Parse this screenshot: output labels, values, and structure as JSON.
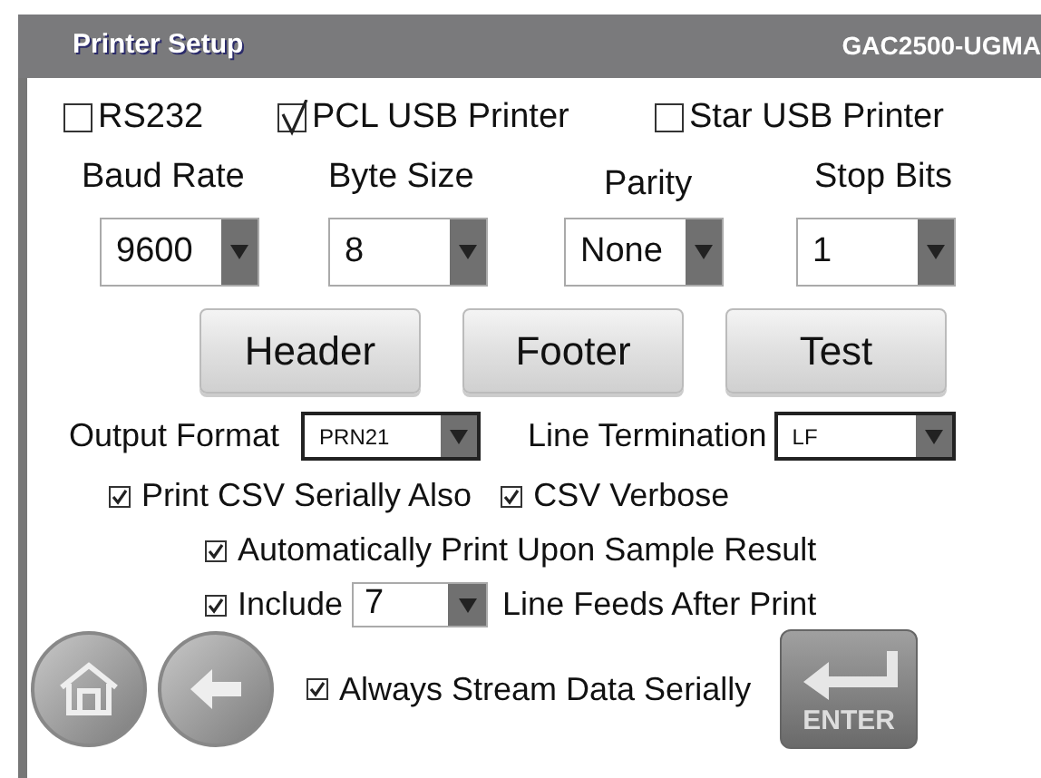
{
  "window": {
    "title": "Printer Setup",
    "model": "GAC2500-UGMA"
  },
  "ports": [
    {
      "label": "RS232",
      "checked": false
    },
    {
      "label": "PCL USB Printer",
      "checked": true
    },
    {
      "label": "Star USB Printer",
      "checked": false
    }
  ],
  "serial_fields": [
    {
      "label": "Baud Rate",
      "value": "9600"
    },
    {
      "label": "Byte Size",
      "value": "8"
    },
    {
      "label": "Parity",
      "value": "None"
    },
    {
      "label": "Stop Bits",
      "value": "1"
    }
  ],
  "buttons": [
    "Header",
    "Footer",
    "Test"
  ],
  "output_format": {
    "label": "Output Format",
    "value": "PRN21"
  },
  "line_termination": {
    "label": "Line Termination",
    "value": "LF"
  },
  "csv_options": [
    {
      "label": "Print CSV Serially Also",
      "checked": true
    },
    {
      "label": "CSV Verbose",
      "checked": true
    }
  ],
  "auto_print": {
    "label": "Automatically Print Upon Sample Result",
    "checked": true
  },
  "line_feeds": {
    "checked": true,
    "prefix": "Include",
    "value": "7",
    "suffix": "Line Feeds After Print"
  },
  "stream": {
    "label": "Always Stream Data Serially",
    "checked": true
  },
  "enter_button": "ENTER"
}
